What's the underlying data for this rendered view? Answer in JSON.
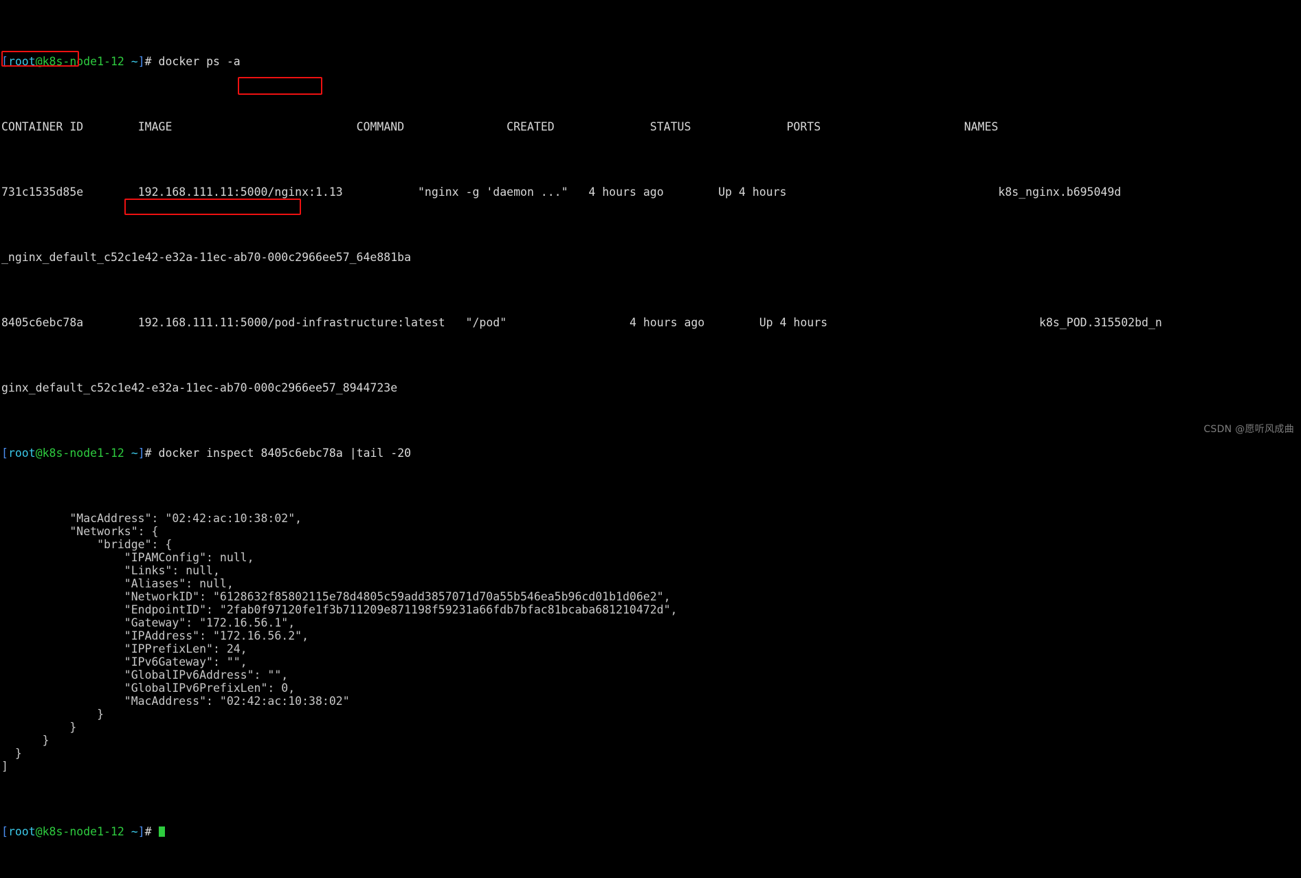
{
  "terminal": {
    "title": "docker ps -a / docker inspect output",
    "background_color": "#000000",
    "foreground_color": "#d8d8d8",
    "prompt": {
      "bracket_open": "[",
      "user": "root",
      "at": "@",
      "host": "k8s-node1-12",
      "space": " ",
      "path": "~",
      "bracket_close": "]",
      "sigil": "# "
    },
    "colors": {
      "prompt_bracket": "#4a8ef0",
      "prompt_user": "#3bc8e8",
      "prompt_host": "#2ecc3f",
      "prompt_path": "#3bc8e8",
      "annotation_red": "#ee1111",
      "cursor_green": "#2ecc3f"
    },
    "commands": {
      "ps": "docker ps -a",
      "inspect_prefix": "docker inspect ",
      "inspect_target": "8405c6ebc78a",
      "inspect_suffix": " |tail -20"
    },
    "ps_table": {
      "headers": {
        "container_id": "CONTAINER ID",
        "image": "IMAGE",
        "command": "COMMAND",
        "created": "CREATED",
        "status": "STATUS",
        "ports": "PORTS",
        "names": "NAMES"
      },
      "rows": [
        {
          "container_id": "731c1535d85e",
          "image": "192.168.111.11:5000/nginx:1.13",
          "command": "\"nginx -g 'daemon ...\"",
          "created": "4 hours ago",
          "status": "Up 4 hours",
          "ports": "",
          "names": "k8s_nginx.b695049d",
          "names_wrap": "_nginx_default_c52c1e42-e32a-11ec-ab70-000c2966ee57_64e881ba"
        },
        {
          "container_id": "8405c6ebc78a",
          "image": "192.168.111.11:5000/pod-infrastructure:latest",
          "command": "\"/pod\"",
          "created": "4 hours ago",
          "status": "Up 4 hours",
          "ports": "",
          "names": "k8s_POD.315502bd_n",
          "names_wrap": "ginx_default_c52c1e42-e32a-11ec-ab70-000c2966ee57_8944723e"
        }
      ]
    },
    "inspect_output": {
      "lines": [
        "          \"MacAddress\": \"02:42:ac:10:38:02\",",
        "          \"Networks\": {",
        "              \"bridge\": {",
        "                  \"IPAMConfig\": null,",
        "                  \"Links\": null,",
        "                  \"Aliases\": null,",
        "                  \"NetworkID\": \"6128632f85802115e78d4805c59add3857071d70a55b546ea5b96cd01b1d06e2\",",
        "                  \"EndpointID\": \"2fab0f97120fe1f3b711209e871198f59231a66fdb7bfac81bcaba681210472d\",",
        "                  \"Gateway\": \"172.16.56.1\",",
        "                  \"IPAddress\": \"172.16.56.2\",",
        "                  \"IPPrefixLen\": 24,",
        "                  \"IPv6Gateway\": \"\",",
        "                  \"GlobalIPv6Address\": \"\",",
        "                  \"GlobalIPv6PrefixLen\": 0,",
        "                  \"MacAddress\": \"02:42:ac:10:38:02\"",
        "              }",
        "          }",
        "      }",
        "  }",
        "]"
      ]
    },
    "annotations": [
      {
        "label": "container-id-highlight",
        "target": "8405c6ebc78a"
      },
      {
        "label": "inspect-arg-highlight",
        "target": "8405c6ebc78a"
      },
      {
        "label": "ipaddress-highlight",
        "target": "\"IPAddress\": \"172.16.56.2\","
      }
    ],
    "watermark": "CSDN @愿听风成曲"
  }
}
